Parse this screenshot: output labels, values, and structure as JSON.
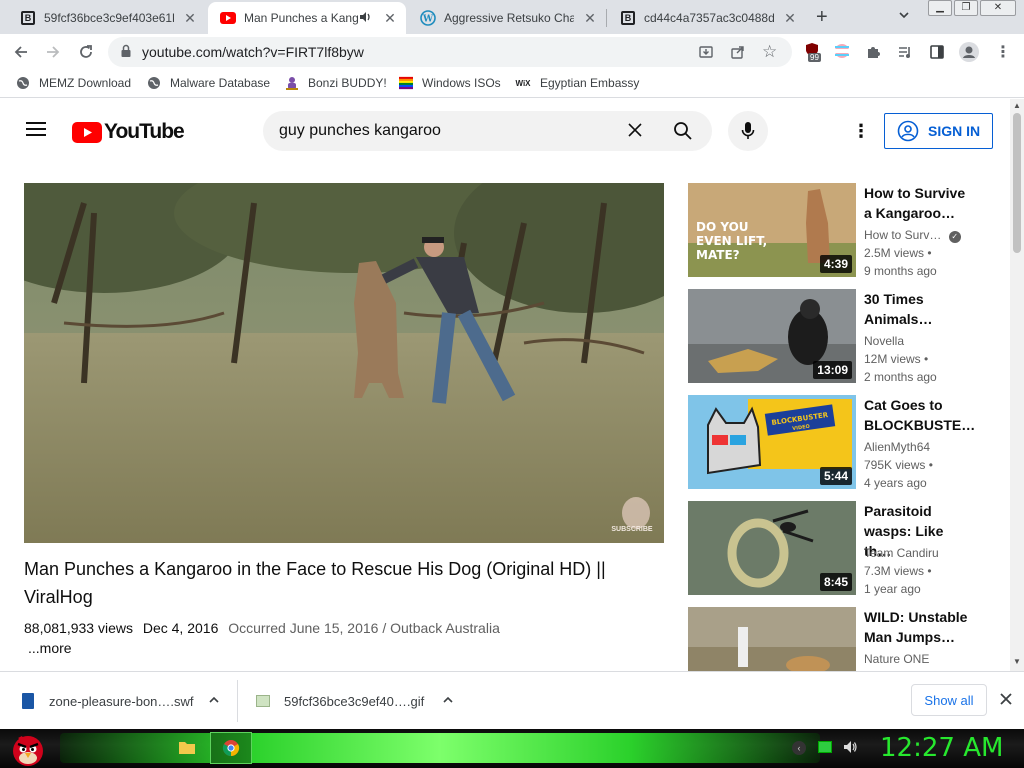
{
  "browser": {
    "tabs": [
      {
        "title": "59fcf36bce3c9ef403e61b",
        "active": false
      },
      {
        "title": "Man Punches a Kang",
        "active": true
      },
      {
        "title": "Aggressive Retsuko Chara",
        "active": false
      },
      {
        "title": "cd44c4a7357ac3c0488d4",
        "active": false
      }
    ],
    "url": "youtube.com/watch?v=FIRT7lf8byw",
    "extension_badge": "99",
    "bookmarks": [
      "MEMZ Download",
      "Malware Database",
      "Bonzi BUDDY!",
      "Windows ISOs",
      "Egyptian Embassy"
    ]
  },
  "youtube": {
    "logo_text": "YouTube",
    "search_query": "guy punches kangaroo",
    "signin_label": "SIGN IN",
    "watermark": "SUBSCRIBE",
    "video": {
      "title": "Man Punches a Kangaroo in the Face to Rescue His Dog (Original HD) || ViralHog",
      "views": "88,081,933 views",
      "date": "Dec 4, 2016",
      "occurred": "Occurred June 15, 2016 / Outback Australia",
      "more_label": "...more"
    },
    "recommendations": [
      {
        "title1": "How to Survive",
        "title2": "a Kangaroo…",
        "channel": "How to Surv…",
        "views": "2.5M views •",
        "age": "9 months ago",
        "duration": "4:39",
        "thumb_text1": "DO YOU",
        "thumb_text2": "EVEN LIFT,",
        "thumb_text3": "MATE?"
      },
      {
        "title1": "30 Times",
        "title2": "Animals…",
        "channel": "Novella",
        "views": "12M views •",
        "age": "2 months ago",
        "duration": "13:09"
      },
      {
        "title1": "Cat Goes to",
        "title2": "BLOCKBUSTE…",
        "channel": "AlienMyth64",
        "views": "795K views •",
        "age": "4 years ago",
        "duration": "5:44",
        "thumb_text1": "BLOCKBUSTER",
        "thumb_text2": "VIDEO"
      },
      {
        "title1": "Parasitoid",
        "title2": "wasps: Like th…",
        "channel": "Team Candiru",
        "views": "7.3M views •",
        "age": "1 year ago",
        "duration": "8:45"
      },
      {
        "title1": "WILD: Unstable",
        "title2": "Man Jumps…",
        "channel": "Nature ONE",
        "views": "",
        "age": "",
        "duration": ""
      }
    ]
  },
  "downloads": {
    "items": [
      "zone-pleasure-bon….swf",
      "59fcf36bce3c9ef40….gif"
    ],
    "show_all_label": "Show all"
  },
  "taskbar": {
    "clock": "12:27 AM"
  }
}
